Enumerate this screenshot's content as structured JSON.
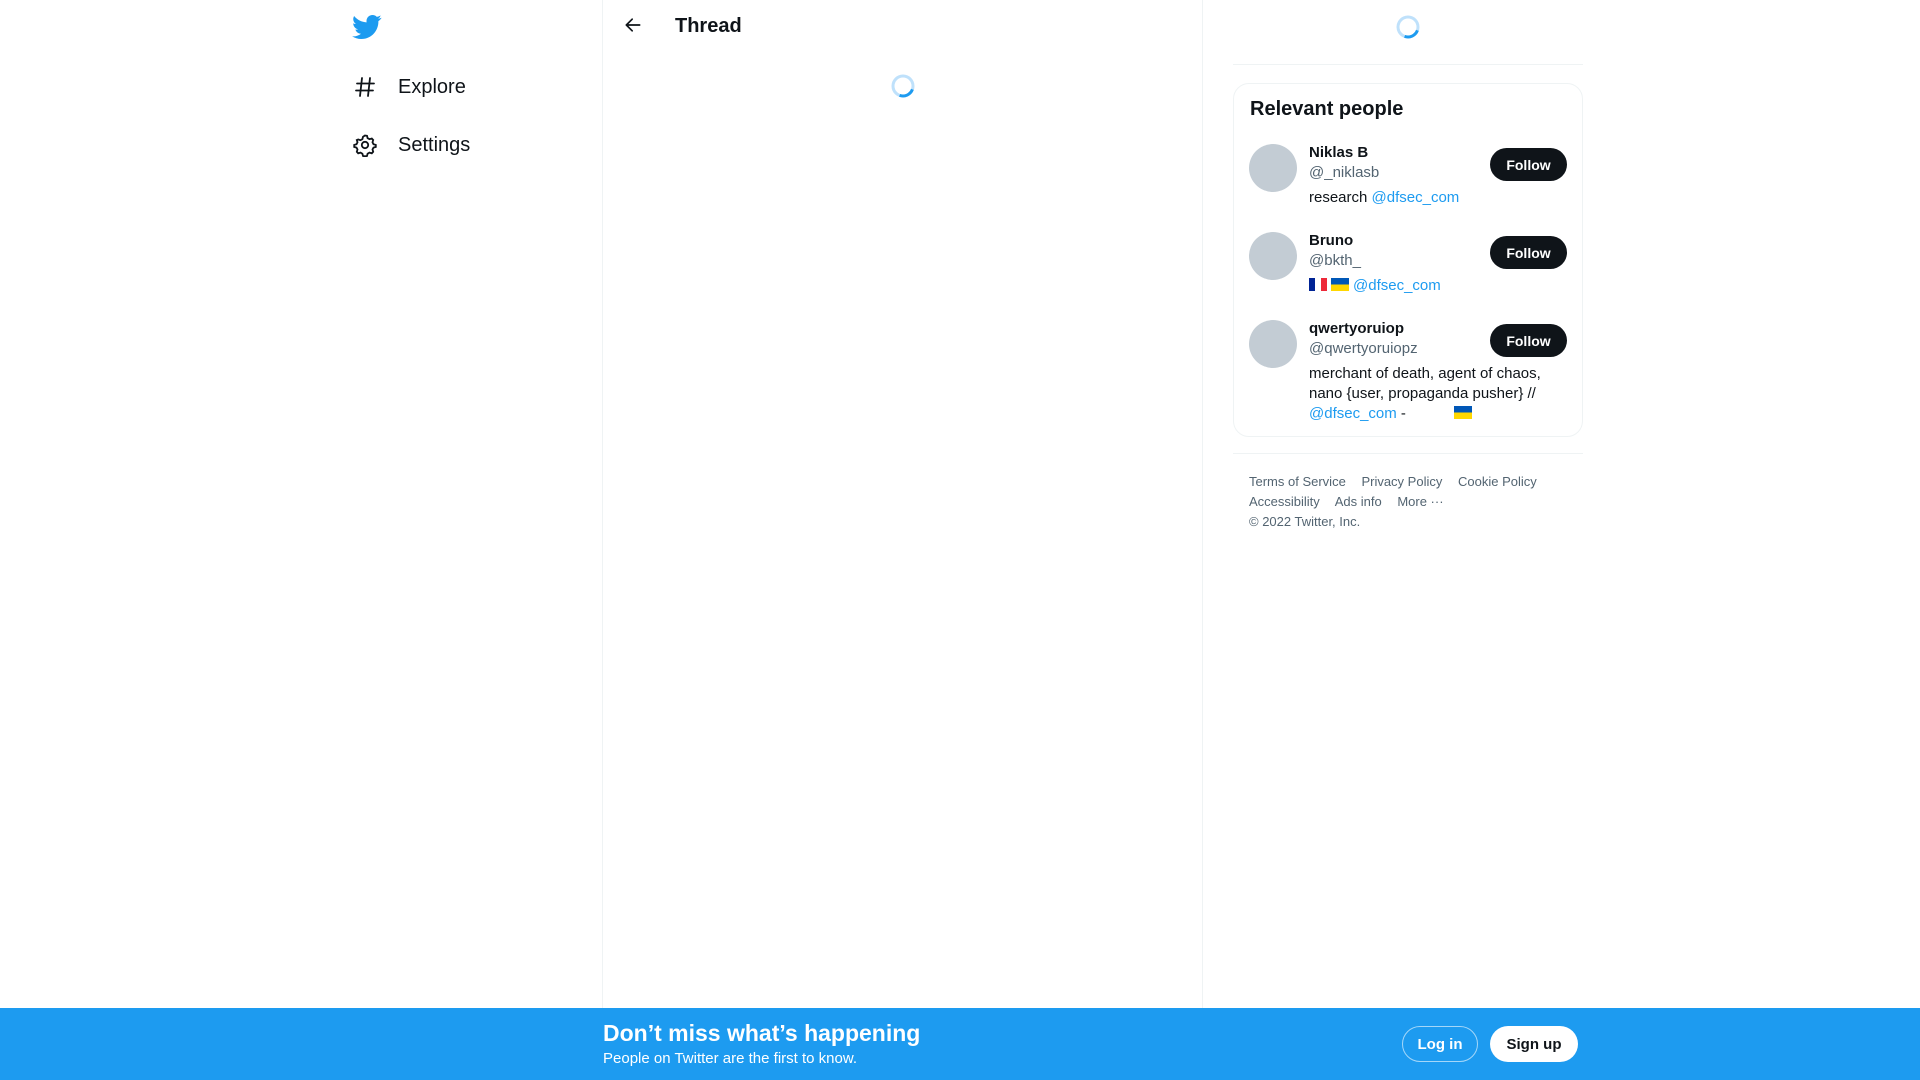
{
  "colors": {
    "brand": "#1d9bf0",
    "text_primary": "#0f1419",
    "text_secondary": "#536471",
    "follow_button_bg": "#0f1419",
    "avatar_placeholder": "#c3ccd4"
  },
  "nav": {
    "logo_icon": "twitter-bird-icon",
    "items": [
      {
        "label": "Explore",
        "icon": "hashtag-icon"
      },
      {
        "label": "Settings",
        "icon": "gear-icon"
      }
    ]
  },
  "main": {
    "back_icon": "arrow-left-icon",
    "title": "Thread",
    "loading_icon": "spinner-icon"
  },
  "sidebar": {
    "loading_icon": "spinner-icon",
    "relevant_people": {
      "title": "Relevant people",
      "people": [
        {
          "name": "Niklas B",
          "handle": "@_niklasb",
          "bio_text": "research ",
          "bio_mention": "@dfsec_com",
          "follow_label": "Follow"
        },
        {
          "name": "Bruno",
          "handle": "@bkth_",
          "bio_flags": [
            "flag-france-icon",
            "flag-ukraine-icon"
          ],
          "bio_mention": "@dfsec_com",
          "follow_label": "Follow"
        },
        {
          "name": "qwertyoruiop",
          "handle": "@qwertyoruiopz",
          "bio_text": "merchant of death, agent of chaos, nano {user, propaganda pusher} //",
          "bio_mention": "@dfsec_com",
          "bio_suffix": " -",
          "bio_flags": [
            "flag-ukraine-icon"
          ],
          "follow_label": "Follow"
        }
      ]
    },
    "footer": {
      "links": [
        "Terms of Service",
        "Privacy Policy",
        "Cookie Policy",
        "Accessibility",
        "Ads info",
        "More ···"
      ],
      "copyright": "© 2022 Twitter, Inc."
    }
  },
  "banner": {
    "title": "Don’t miss what’s happening",
    "subtitle": "People on Twitter are the first to know.",
    "login_label": "Log in",
    "signup_label": "Sign up"
  }
}
